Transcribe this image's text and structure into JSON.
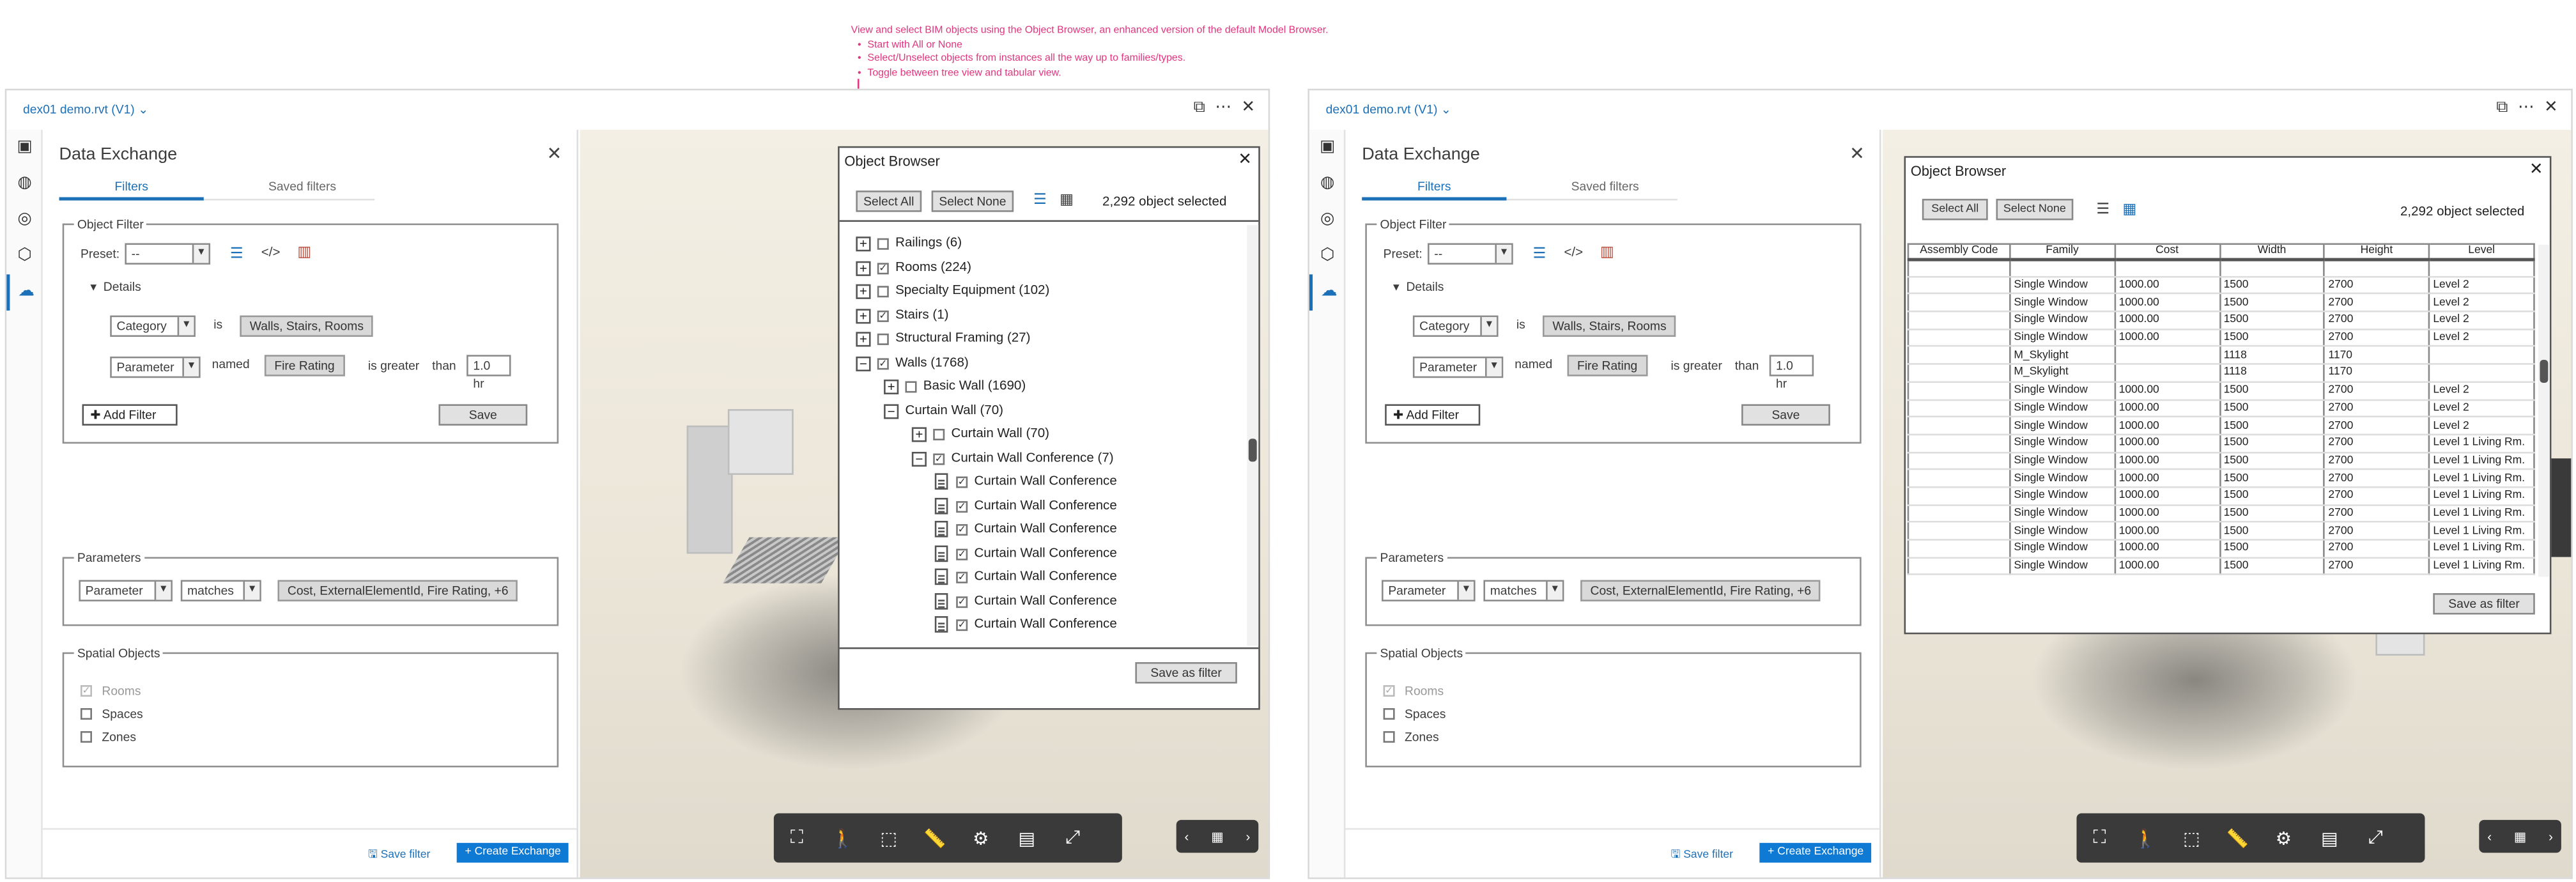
{
  "annotation": {
    "headline": "View and select BIM objects using the Object Browser, an enhanced version of the default Model Browser.",
    "bullets": [
      "Start with All or None",
      "Select/Unselect objects from instances all the way up to families/types.",
      "Toggle between tree view and tabular view."
    ],
    "color": "#e0357f"
  },
  "window": {
    "file_name": "dex01 demo.rvt",
    "version": "(V1)",
    "accent": "#1b70b8"
  },
  "panel": {
    "title": "Data Exchange",
    "tabs": [
      "Filters",
      "Saved filters"
    ],
    "object_filter": {
      "legend": "Object Filter",
      "preset_label": "Preset:",
      "preset_value": "--",
      "details_label": "Details",
      "row1": {
        "select": "Category",
        "verb": "is",
        "chip": "Walls, Stairs, Rooms"
      },
      "row2": {
        "select": "Parameter",
        "verb": "named",
        "chip": "Fire Rating",
        "cmp1": "is greater",
        "cmp2": "than",
        "value": "1.0 hr"
      },
      "add_filter": "Add Filter",
      "save": "Save"
    },
    "parameters": {
      "legend": "Parameters",
      "select1": "Parameter",
      "select2": "matches",
      "chip": "Cost, ExternalElementId, Fire Rating, +6"
    },
    "spatial": {
      "legend": "Spatial Objects",
      "items": [
        {
          "label": "Rooms",
          "checked": true,
          "disabled": true
        },
        {
          "label": "Spaces",
          "checked": false
        },
        {
          "label": "Zones",
          "checked": false
        }
      ]
    },
    "footer": {
      "save_filter": "Save filter",
      "create_exchange": "+ Create Exchange"
    }
  },
  "object_browser": {
    "title": "Object Browser",
    "select_all": "Select All",
    "select_none": "Select None",
    "count": "2,292 object selected",
    "save_as_filter": "Save as filter",
    "tree": [
      {
        "label": "Railings (6)",
        "level": 0,
        "expander": "+",
        "checked": false
      },
      {
        "label": "Rooms (224)",
        "level": 0,
        "expander": "+",
        "checked": true
      },
      {
        "label": "Specialty Equipment (102)",
        "level": 0,
        "expander": "+",
        "checked": false
      },
      {
        "label": "Stairs (1)",
        "level": 0,
        "expander": "+",
        "checked": true
      },
      {
        "label": "Structural Framing (27)",
        "level": 0,
        "expander": "+",
        "checked": false
      },
      {
        "label": "Walls (1768)",
        "level": 0,
        "expander": "−",
        "checked": true
      },
      {
        "label": "Basic Wall (1690)",
        "level": 1,
        "expander": "+",
        "checked": false
      },
      {
        "label": "Curtain Wall (70)",
        "level": 1,
        "expander": "−",
        "checked": null
      },
      {
        "label": "Curtain Wall (70)",
        "level": 2,
        "expander": "+",
        "checked": false
      },
      {
        "label": "Curtain Wall Conference (7)",
        "level": 2,
        "expander": "−",
        "checked": true
      },
      {
        "label": "Curtain Wall Conference",
        "level": 3,
        "expander": "doc",
        "checked": true
      },
      {
        "label": "Curtain Wall Conference",
        "level": 3,
        "expander": "doc",
        "checked": true
      },
      {
        "label": "Curtain Wall Conference",
        "level": 3,
        "expander": "doc",
        "checked": true
      },
      {
        "label": "Curtain Wall Conference",
        "level": 3,
        "expander": "doc",
        "checked": true
      },
      {
        "label": "Curtain Wall Conference",
        "level": 3,
        "expander": "doc",
        "checked": true
      },
      {
        "label": "Curtain Wall Conference",
        "level": 3,
        "expander": "doc",
        "checked": true
      },
      {
        "label": "Curtain Wall Conference",
        "level": 3,
        "expander": "doc",
        "checked": true
      }
    ],
    "table": {
      "headers": [
        "Assembly Code",
        "Family",
        "Cost",
        "Width",
        "Height",
        "Level"
      ],
      "rows": [
        [
          "",
          "Single Window",
          "1000.00",
          "1500",
          "2700",
          "Level 2"
        ],
        [
          "",
          "Single Window",
          "1000.00",
          "1500",
          "2700",
          "Level 2"
        ],
        [
          "",
          "Single Window",
          "1000.00",
          "1500",
          "2700",
          "Level 2"
        ],
        [
          "",
          "Single Window",
          "1000.00",
          "1500",
          "2700",
          "Level 2"
        ],
        [
          "",
          "M_Skylight",
          "",
          "1118",
          "1170",
          ""
        ],
        [
          "",
          "M_Skylight",
          "",
          "1118",
          "1170",
          ""
        ],
        [
          "",
          "Single Window",
          "1000.00",
          "1500",
          "2700",
          "Level 2"
        ],
        [
          "",
          "Single Window",
          "1000.00",
          "1500",
          "2700",
          "Level 2"
        ],
        [
          "",
          "Single Window",
          "1000.00",
          "1500",
          "2700",
          "Level 2"
        ],
        [
          "",
          "Single Window",
          "1000.00",
          "1500",
          "2700",
          "Level 1 Living Rm."
        ],
        [
          "",
          "Single Window",
          "1000.00",
          "1500",
          "2700",
          "Level 1 Living Rm."
        ],
        [
          "",
          "Single Window",
          "1000.00",
          "1500",
          "2700",
          "Level 1 Living Rm."
        ],
        [
          "",
          "Single Window",
          "1000.00",
          "1500",
          "2700",
          "Level 1 Living Rm."
        ],
        [
          "",
          "Single Window",
          "1000.00",
          "1500",
          "2700",
          "Level 1 Living Rm."
        ],
        [
          "",
          "Single Window",
          "1000.00",
          "1500",
          "2700",
          "Level 1 Living Rm."
        ],
        [
          "",
          "Single Window",
          "1000.00",
          "1500",
          "2700",
          "Level 1 Living Rm."
        ],
        [
          "",
          "Single Window",
          "1000.00",
          "1500",
          "2700",
          "Level 1 Living Rm."
        ]
      ]
    }
  },
  "icons": {
    "rail": [
      "revit-icon",
      "globe-icon",
      "check-circle-icon",
      "cube-icon",
      "cloud-exchange-icon"
    ],
    "titlebar": [
      "window-toggle-icon",
      "more-icon",
      "close-icon"
    ],
    "viewer_toolbar": [
      "fit-view-icon",
      "walk-icon",
      "zoom-window-icon",
      "measure-icon",
      "settings-icon",
      "properties-icon",
      "fullscreen-icon"
    ]
  }
}
